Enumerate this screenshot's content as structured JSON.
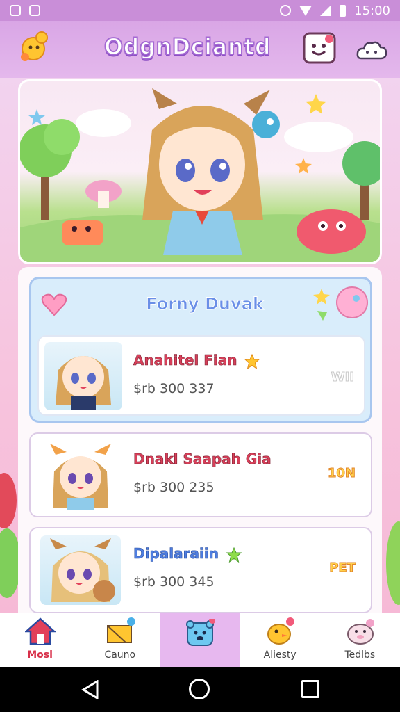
{
  "status_bar": {
    "time": "15:00"
  },
  "header": {
    "title": "OdgnDciantd"
  },
  "featured": {
    "title": "Forny Duvak"
  },
  "cards": [
    {
      "name": "Anahitel Fian",
      "price": "$rb 300 337",
      "badge": "WII"
    },
    {
      "name": "Dnakl Saapah Gia",
      "price": "$rb 300 235",
      "badge": "10N"
    },
    {
      "name": "Dipalaraiin",
      "price": "$rb 300 345",
      "badge": "PET"
    }
  ],
  "bottom_nav": [
    {
      "label": "Mosi",
      "icon": "home-icon"
    },
    {
      "label": "Cauno",
      "icon": "basket-icon"
    },
    {
      "label": "",
      "icon": "bear-face-icon"
    },
    {
      "label": "Aliesty",
      "icon": "chick-icon"
    },
    {
      "label": "Tedlbs",
      "icon": "pig-icon"
    }
  ],
  "colors": {
    "accent": "#c98ed8",
    "title_outline": "#a46ad3",
    "active_nav": "#e7b8ef"
  }
}
